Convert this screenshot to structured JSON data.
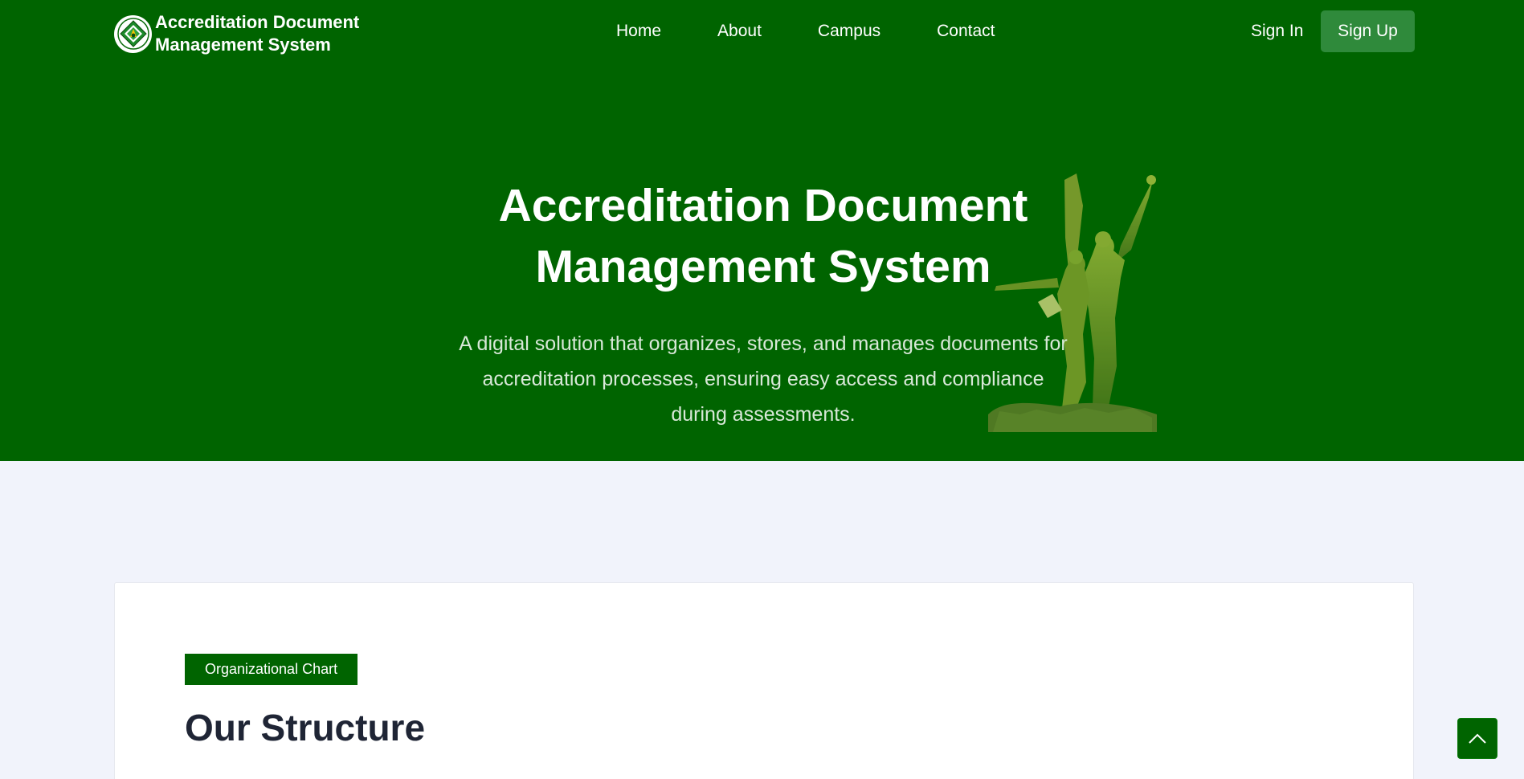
{
  "header": {
    "brand_line1": "Accreditation Document",
    "brand_line2": "Management System",
    "nav": [
      "Home",
      "About",
      "Campus",
      "Contact"
    ],
    "sign_in": "Sign In",
    "sign_up": "Sign Up"
  },
  "hero": {
    "title_line1": "Accreditation Document",
    "title_line2": "Management System",
    "subtitle": "A digital solution that organizes, stores, and manages documents for accreditation processes, ensuring easy access and compliance during assessments."
  },
  "section": {
    "badge": "Organizational Chart",
    "title": "Our Structure"
  },
  "icons": {
    "logo": "seal-icon",
    "statue": "statue-image",
    "scroll_top": "chevron-up-icon"
  },
  "colors": {
    "primary_green": "#006400",
    "sign_up_button": "#2f8a3b",
    "page_background": "#f1f3fb",
    "heading_dark": "#1f2535"
  }
}
